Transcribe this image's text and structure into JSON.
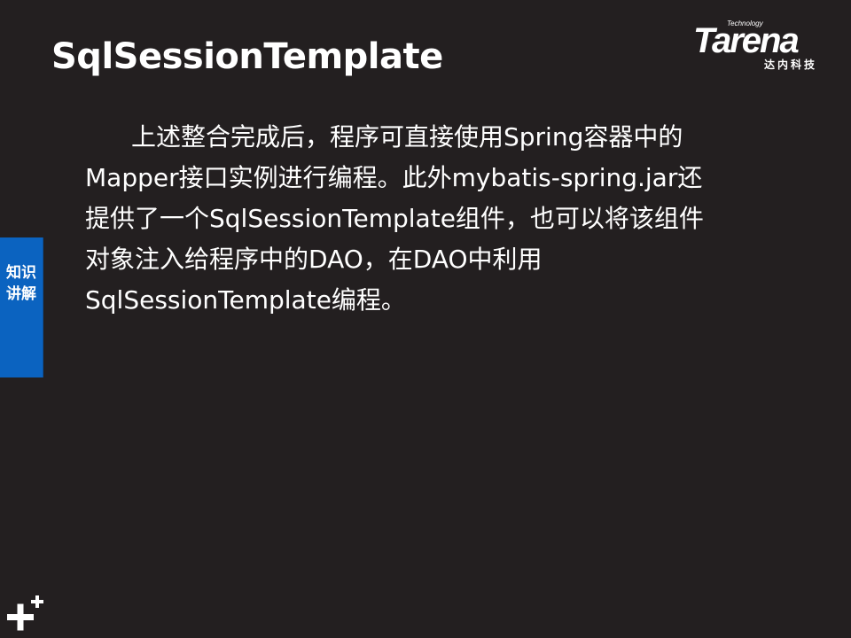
{
  "slide": {
    "title": "SqlSessionTemplate",
    "body_lines": [
      "上述整合完成后，程序可直接使用Spring容器中的",
      "Mapper接口实例进行编程。此外mybatis-spring.jar还",
      "提供了一个SqlSessionTemplate组件，也可以将该组件",
      "对象注入给程序中的DAO，在DAO中利用",
      "SqlSessionTemplate编程。"
    ]
  },
  "logo": {
    "tag": "Technology",
    "wordmark": "Tarena",
    "chinese": "达内科技"
  },
  "side_tab": {
    "label": "知识讲解"
  },
  "colors": {
    "background": "#231f20",
    "text": "#ffffff",
    "tab": "#0b63c0"
  },
  "icons": {
    "corner": "plus-icon"
  }
}
